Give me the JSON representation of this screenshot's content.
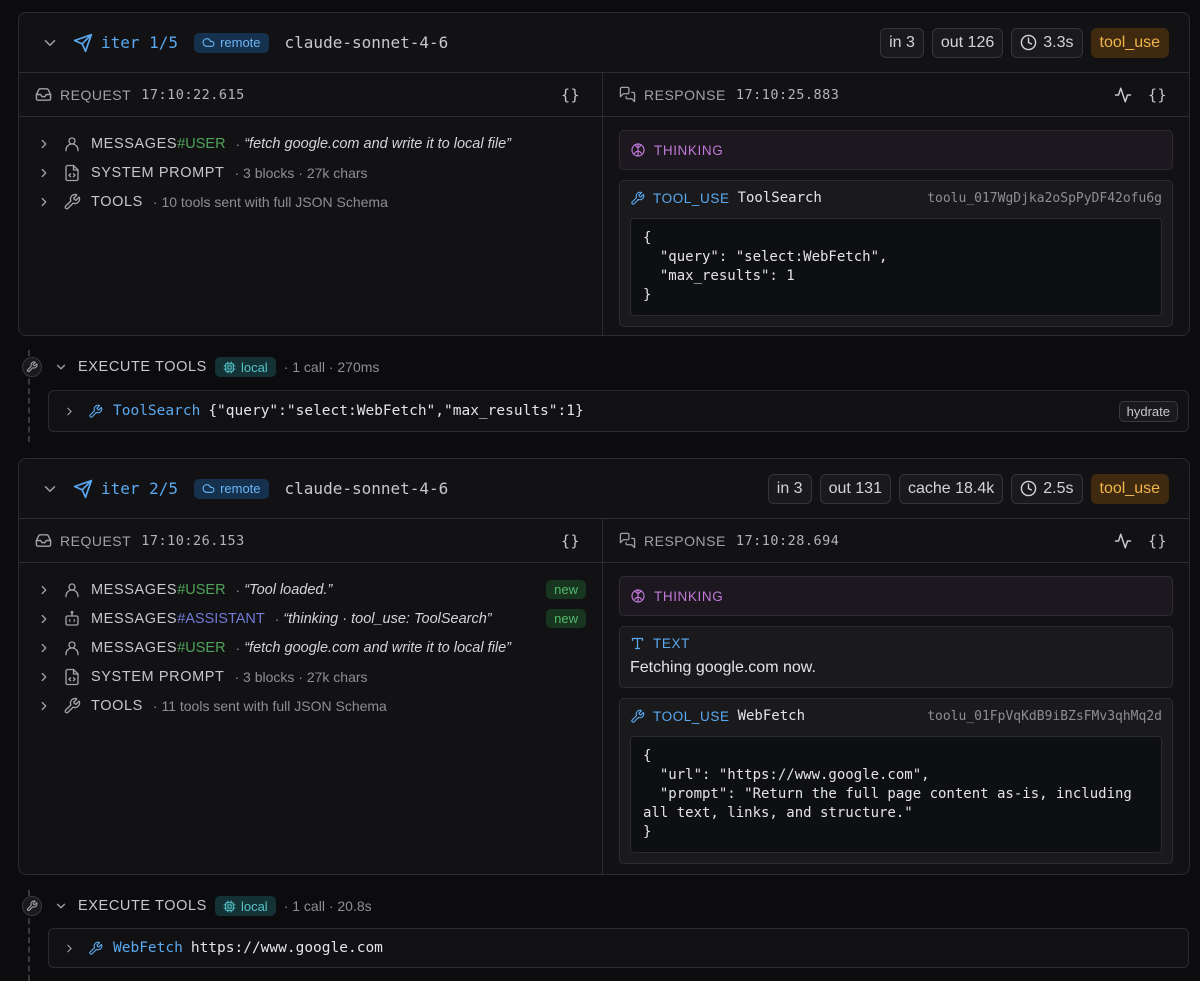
{
  "iterations": [
    {
      "label": "iter 1/5",
      "location": "remote",
      "model": "claude-sonnet-4-6",
      "stats": {
        "in": "in 3",
        "out": "out 126",
        "duration": "3.3s",
        "stop": "tool_use"
      },
      "request": {
        "title": "REQUEST",
        "timestamp": "17:10:22.615",
        "braces": "{}",
        "rows": [
          {
            "label": "MESSAGES",
            "role": "#USER",
            "quote": "“fetch google.com and write it to local file”"
          },
          {
            "label": "SYSTEM PROMPT",
            "meta": "· 3 blocks · 27k chars"
          },
          {
            "label": "TOOLS",
            "meta": "· 10 tools sent with full JSON Schema"
          }
        ]
      },
      "response": {
        "title": "RESPONSE",
        "timestamp": "17:10:25.883",
        "braces": "{}",
        "thinking": "THINKING",
        "tool_use": {
          "tag": "TOOL_USE",
          "name": "ToolSearch",
          "id": "toolu_017WgDjka2oSpPyDF42ofu6g",
          "json": "{\n  \"query\": \"select:WebFetch\",\n  \"max_results\": 1\n}"
        }
      }
    },
    {
      "label": "iter 2/5",
      "location": "remote",
      "model": "claude-sonnet-4-6",
      "stats": {
        "in": "in 3",
        "out": "out 131",
        "cache": "cache 18.4k",
        "duration": "2.5s",
        "stop": "tool_use"
      },
      "request": {
        "title": "REQUEST",
        "timestamp": "17:10:26.153",
        "braces": "{}",
        "rows": [
          {
            "label": "MESSAGES",
            "role": "#USER",
            "quote": "“Tool loaded.”",
            "badge": "new"
          },
          {
            "label": "MESSAGES",
            "role": "#ASSISTANT",
            "quote": "“thinking · tool_use: ToolSearch”",
            "badge": "new"
          },
          {
            "label": "MESSAGES",
            "role": "#USER",
            "quote": "“fetch google.com and write it to local file”"
          },
          {
            "label": "SYSTEM PROMPT",
            "meta": "· 3 blocks · 27k chars"
          },
          {
            "label": "TOOLS",
            "meta": "· 11 tools sent with full JSON Schema"
          }
        ]
      },
      "response": {
        "title": "RESPONSE",
        "timestamp": "17:10:28.694",
        "braces": "{}",
        "thinking": "THINKING",
        "text": {
          "tag": "TEXT",
          "body": "Fetching google.com now."
        },
        "tool_use": {
          "tag": "TOOL_USE",
          "name": "WebFetch",
          "id": "toolu_01FpVqKdB9iBZsFMv3qhMq2d",
          "json": "{\n  \"url\": \"https://www.google.com\",\n  \"prompt\": \"Return the full page content as-is, including\nall text, links, and structure.\"\n}"
        }
      }
    }
  ],
  "executions": [
    {
      "title": "EXECUTE TOOLS",
      "location": "local",
      "meta": "· 1 call · 270ms",
      "call": {
        "name": "ToolSearch",
        "args": "{\"query\":\"select:WebFetch\",\"max_results\":1}",
        "action": "hydrate"
      }
    },
    {
      "title": "EXECUTE TOOLS",
      "location": "local",
      "meta": "· 1 call · 20.8s",
      "call": {
        "name": "WebFetch",
        "args": "https://www.google.com"
      }
    }
  ]
}
